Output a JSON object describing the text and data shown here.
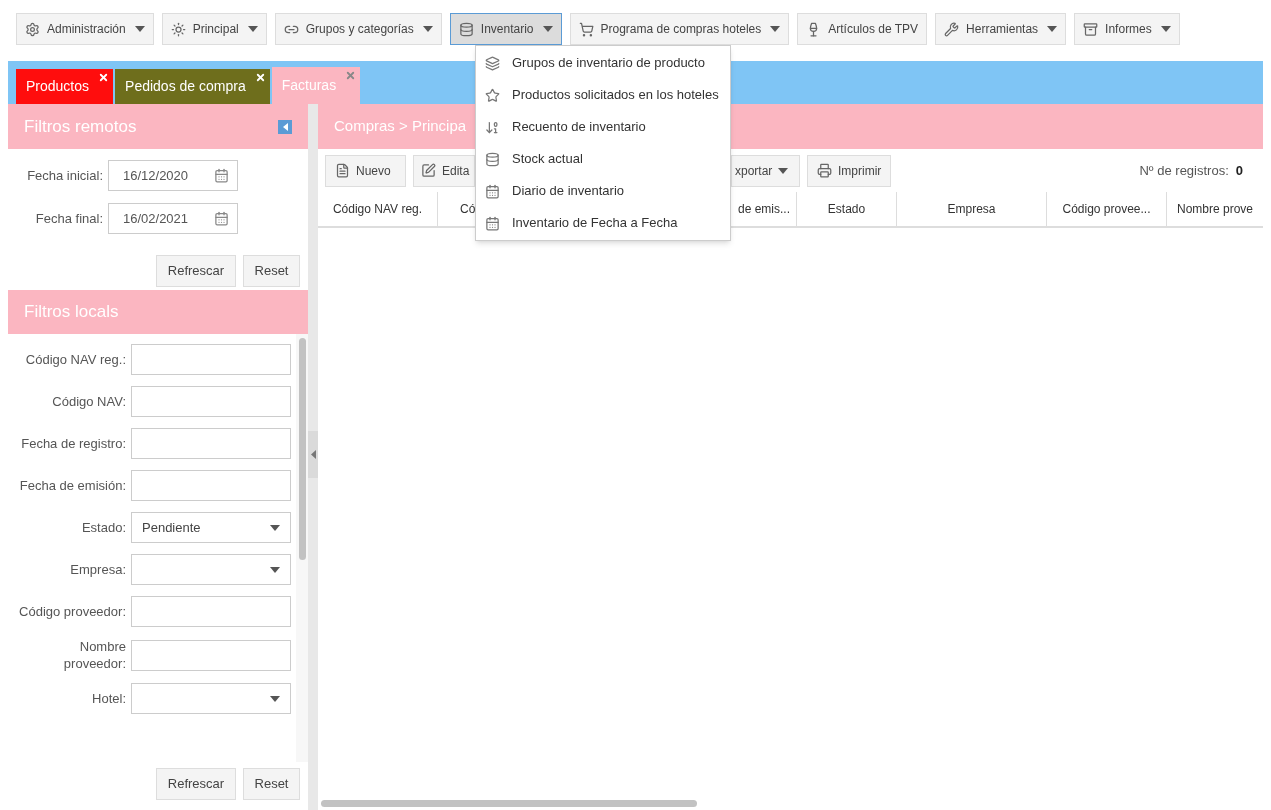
{
  "top_menu": [
    {
      "label": "Administración",
      "caret": true,
      "selected": false
    },
    {
      "label": "Principal",
      "caret": true,
      "selected": false
    },
    {
      "label": "Grupos y categorías",
      "caret": true,
      "selected": false
    },
    {
      "label": "Inventario",
      "caret": true,
      "selected": true
    },
    {
      "label": "Programa de compras hoteles",
      "caret": true,
      "selected": false
    },
    {
      "label": "Artículos de TPV",
      "caret": false,
      "selected": false
    },
    {
      "label": "Herramientas",
      "caret": true,
      "selected": false
    },
    {
      "label": "Informes",
      "caret": true,
      "selected": false
    }
  ],
  "dropdown": [
    {
      "label": "Grupos de inventario de producto"
    },
    {
      "label": "Productos solicitados en los hoteles"
    },
    {
      "label": "Recuento de inventario"
    },
    {
      "label": "Stock actual"
    },
    {
      "label": "Diario de inventario"
    },
    {
      "label": "Inventario de Fecha a Fecha"
    }
  ],
  "tabs": [
    {
      "label": "Productos",
      "color": "#ff0d0d",
      "selected": false
    },
    {
      "label": "Pedidos de compra",
      "color": "#6e6e1c",
      "selected": false
    },
    {
      "label": "Facturas",
      "color": "#fbb6c1",
      "selected": true
    }
  ],
  "remote_filters": {
    "title": "Filtros remotos",
    "fields": [
      {
        "label": "Fecha inicial:",
        "value": "16/12/2020"
      },
      {
        "label": "Fecha final:",
        "value": "16/02/2021"
      }
    ],
    "buttons": [
      "Refrescar",
      "Reset"
    ]
  },
  "local_filters": {
    "title": "Filtros locals",
    "fields": [
      {
        "label": "Código NAV reg.:",
        "kind": "text"
      },
      {
        "label": "Código NAV:",
        "kind": "text"
      },
      {
        "label": "Fecha de registro:",
        "kind": "text"
      },
      {
        "label": "Fecha de emisión:",
        "kind": "text"
      },
      {
        "label": "Estado:",
        "kind": "select",
        "value": "Pendiente"
      },
      {
        "label": "Empresa:",
        "kind": "select"
      },
      {
        "label": "Código proveedor:",
        "kind": "text"
      },
      {
        "label": "Nombre proveedor:",
        "kind": "text"
      },
      {
        "label": "Hotel:",
        "kind": "select"
      }
    ],
    "buttons": [
      "Refrescar",
      "Reset"
    ]
  },
  "main": {
    "breadcrumb": "Compras > Principa",
    "toolbar": [
      {
        "label": "Nuevo",
        "caret": false
      },
      {
        "label": "Edita",
        "caret": false
      },
      {
        "label": "xportar",
        "caret": true
      },
      {
        "label": "Imprimir",
        "caret": false
      }
    ],
    "record_count_label": "Nº de registros:",
    "record_count": "0",
    "columns": [
      "Código NAV reg.",
      "Có",
      "de emis...",
      "Estado",
      "Empresa",
      "Código provee...",
      "Nombre prove"
    ]
  }
}
